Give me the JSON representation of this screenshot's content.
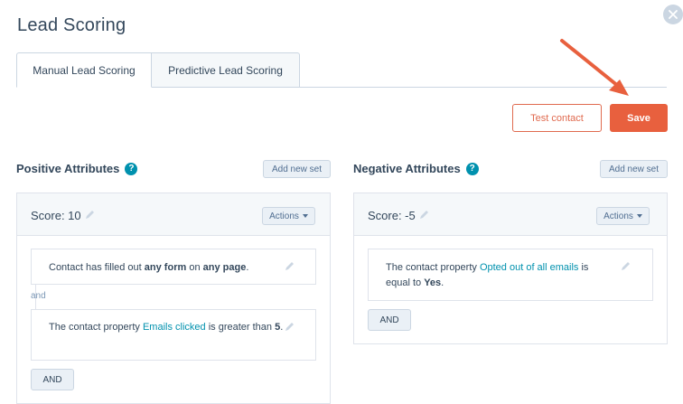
{
  "page": {
    "title": "Lead Scoring"
  },
  "tabs": [
    {
      "label": "Manual Lead Scoring",
      "active": true
    },
    {
      "label": "Predictive Lead Scoring",
      "active": false
    }
  ],
  "actions": {
    "test_label": "Test contact",
    "save_label": "Save"
  },
  "positive": {
    "heading": "Positive Attributes",
    "add_set_label": "Add new set",
    "score_label": "Score: 10",
    "actions_label": "Actions",
    "criteria": [
      {
        "pre": "Contact has filled out ",
        "b1": "any form",
        "mid": " on ",
        "b2": "any page",
        "post": "."
      },
      {
        "pre": "The contact property ",
        "link": "Emails clicked",
        "mid": " is greater than ",
        "value": "5",
        "post": "."
      }
    ],
    "and_joiner": "and",
    "and_button": "AND"
  },
  "negative": {
    "heading": "Negative Attributes",
    "add_set_label": "Add new set",
    "score_label": "Score: -5",
    "actions_label": "Actions",
    "criteria": [
      {
        "pre": "The contact property ",
        "link": "Opted out of all emails",
        "mid": " is equal to ",
        "value": "Yes",
        "post": "."
      }
    ],
    "and_button": "AND"
  },
  "colors": {
    "accent": "#e8603e",
    "link": "#0091ae",
    "text": "#33475b"
  },
  "icons": {
    "close": "close-icon",
    "help": "help-icon",
    "edit": "pencil-icon",
    "annotation": "arrow-annotation"
  }
}
